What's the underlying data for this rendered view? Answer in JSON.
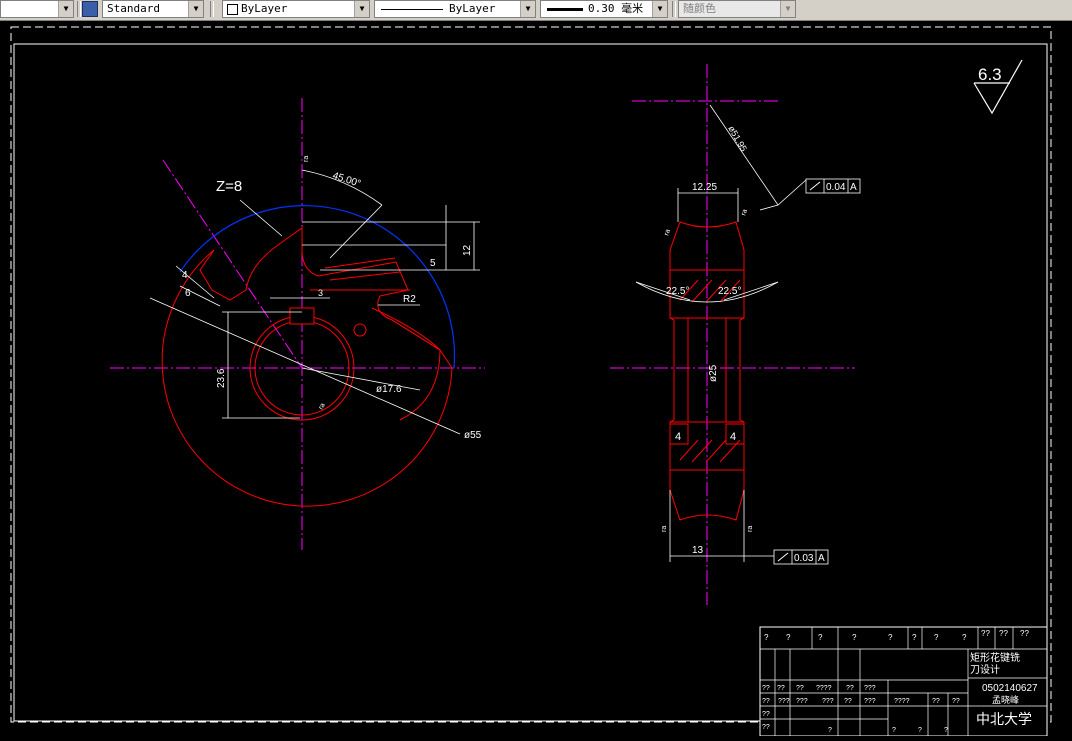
{
  "toolbar": {
    "text_style": "Standard",
    "color": "ByLayer",
    "linetype": "ByLayer",
    "lineweight": "0.30 毫米",
    "plot_style": "随颜色"
  },
  "drawing": {
    "roughness": "6.3",
    "teeth_count": "Z=8",
    "angle_45": "45.00°",
    "dim_5": "5",
    "dim_12": "12",
    "dim_4": "4",
    "dim_6": "6",
    "dim_r2": "R2",
    "dim_3": "3",
    "dim_23_6": "23.6",
    "dim_17_6": "ø17.6",
    "dim_55": "ø55",
    "dim_12_25": "12.25",
    "dim_51": "ø51.95",
    "dim_22_5_left": "22.5°",
    "dim_22_5_right": "22.5°",
    "dim_25": "ø25",
    "dim_4_left": "4",
    "dim_4_right": "4",
    "dim_13": "13",
    "tol_top_value": "0.04",
    "tol_top_datum": "A",
    "tol_bottom_value": "0.03",
    "tol_bottom_datum": "A",
    "rough_small": "ra"
  },
  "title_block": {
    "q": "?",
    "qq": "??",
    "qqq": "???",
    "qqqq": "????",
    "part_name_1": "矩形花键铣",
    "part_name_2": "刀设计",
    "student_id": "0502140627",
    "student_name": "孟晓峰",
    "school": "中北大学"
  }
}
